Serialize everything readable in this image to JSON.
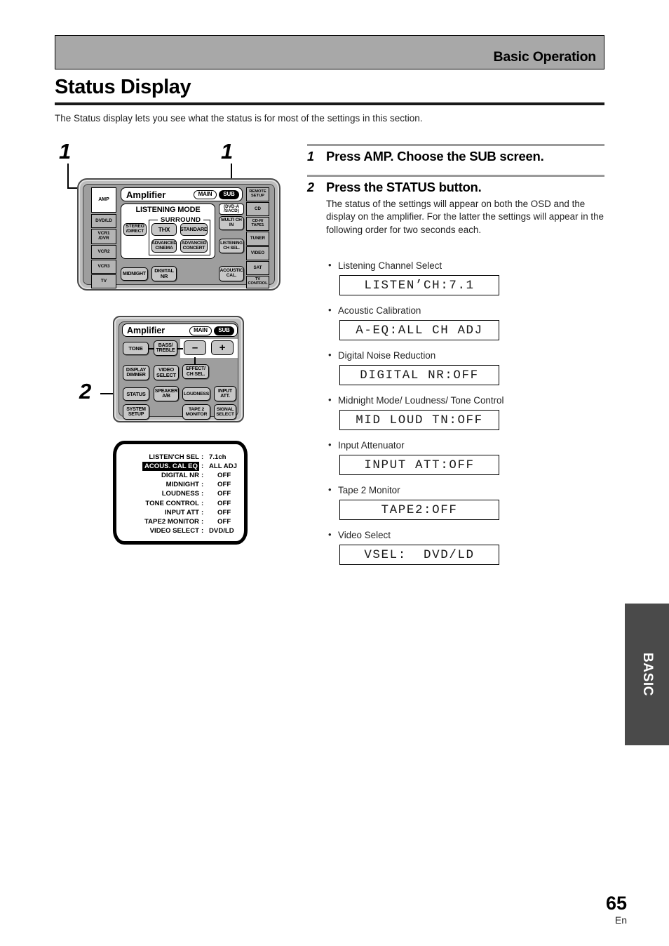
{
  "header": {
    "section_title": "Basic Operation"
  },
  "page": {
    "title": "Status Display",
    "intro": "The Status display lets you see what the status is for most of the settings in this section.",
    "folio_number": "65",
    "folio_lang": "En",
    "side_tab": "BASIC"
  },
  "callouts": {
    "one_left": "1",
    "one_right": "1",
    "two": "2"
  },
  "remote_amp": {
    "screen_label": "Amplifier",
    "main_tab": "MAIN",
    "sub_tab": "SUB",
    "listening_mode_label": "LISTENING MODE",
    "surround_label": "SURROUND",
    "stereo_direct": "STEREO\n/DIRECT",
    "thx": "THX",
    "standard": "STANDARD",
    "advanced_cinema": "ADVANCED\nCINEMA",
    "advanced_concert": "ADVANCED\nCONCERT",
    "dvd_a_sacd": "(DVD-A\n/SACD)",
    "multi_ch_in": "MULTI CH\nIN",
    "listening_ch_sel": "LISTENING\nCH SEL.",
    "midnight": "MIDNIGHT",
    "digital_nr": "DIGITAL\nNR",
    "acoustic_cal": "ACOUSTIC\nCAL.",
    "source_left": [
      "AMP",
      "DVD/LD",
      "VCR1\n/DVR",
      "VCR2",
      "VCR3",
      "TV"
    ],
    "source_right": [
      "REMOTE\nSETUP",
      "CD",
      "CD-R/\nTAPE1",
      "TUNER",
      "VIDEO",
      "SAT",
      "TV\nCONTROL"
    ]
  },
  "remote_status": {
    "screen_label": "Amplifier",
    "main_tab": "MAIN",
    "sub_tab": "SUB",
    "tone": "TONE",
    "bass_treble": "BASS/\nTREBLE",
    "minus": "–",
    "plus": "+",
    "effect_ch_sel": "EFFECT/\nCH SEL.",
    "display_dimmer": "DISPLAY\nDIMMER",
    "video_select": "VIDEO\nSELECT",
    "status": "STATUS",
    "speaker_ab": "SPEAKER\nA/B",
    "loudness": "LOUDNESS",
    "input_att": "INPUT\nATT.",
    "system_setup": "SYSTEM\nSETUP",
    "tape2_monitor": "TAPE 2\nMONITOR",
    "signal_select": "SIGNAL\nSELECT"
  },
  "osd": {
    "rows": [
      {
        "label": "LISTEN'CH SEL",
        "value": "7.1ch",
        "highlight": false,
        "value_center": false
      },
      {
        "label": "ACOUS. CAL EQ",
        "value": "ALL ADJ",
        "highlight": true,
        "value_center": false
      },
      {
        "label": "DIGITAL NR",
        "value": "OFF",
        "highlight": false,
        "value_center": true
      },
      {
        "label": "MIDNIGHT",
        "value": "OFF",
        "highlight": false,
        "value_center": true
      },
      {
        "label": "LOUDNESS",
        "value": "OFF",
        "highlight": false,
        "value_center": true
      },
      {
        "label": "TONE CONTROL",
        "value": "OFF",
        "highlight": false,
        "value_center": true
      },
      {
        "label": "INPUT ATT",
        "value": "OFF",
        "highlight": false,
        "value_center": true
      },
      {
        "label": "TAPE2 MONITOR",
        "value": "OFF",
        "highlight": false,
        "value_center": true
      },
      {
        "label": "VIDEO SELECT",
        "value": "DVD/LD",
        "highlight": false,
        "value_center": false
      }
    ]
  },
  "steps": [
    {
      "num": "1",
      "heading": "Press AMP. Choose the SUB screen.",
      "body": ""
    },
    {
      "num": "2",
      "heading": "Press the STATUS button.",
      "body": "The status of the settings will appear on both the OSD and the display on the amplifier. For the latter the settings will appear in the following order for two seconds each."
    }
  ],
  "readouts": [
    {
      "caption": "Listening Channel Select",
      "display": "LISTEN’CH:7.1"
    },
    {
      "caption": "Acoustic Calibration",
      "display": "A-EQ:ALL CH ADJ"
    },
    {
      "caption": "Digital Noise Reduction",
      "display": "DIGITAL NR:OFF"
    },
    {
      "caption": "Midnight Mode/ Loudness/ Tone Control",
      "display": "MID LOUD TN:OFF"
    },
    {
      "caption": "Input Attenuator",
      "display": "INPUT ATT:OFF"
    },
    {
      "caption": "Tape 2 Monitor",
      "display": "TAPE2:OFF"
    },
    {
      "caption": "Video Select",
      "display": "VSEL:  DVD/LD"
    }
  ]
}
